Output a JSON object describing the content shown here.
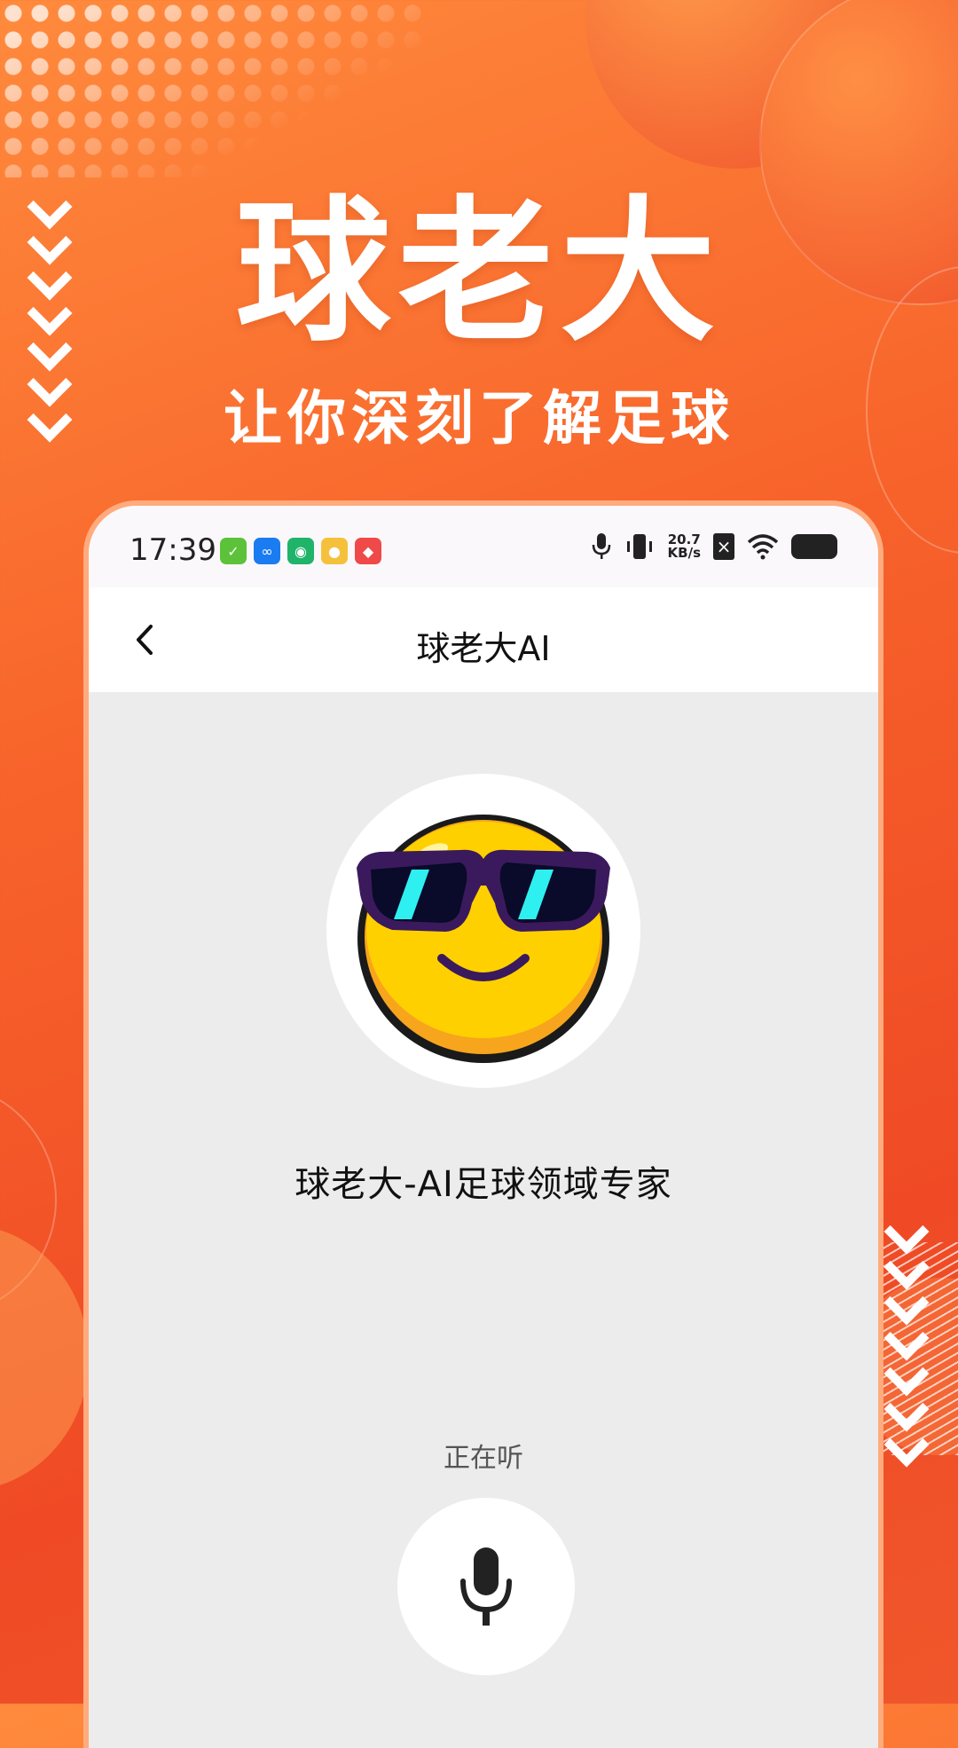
{
  "promo": {
    "headline": "球老大",
    "subline": "让你深刻了解足球"
  },
  "status_bar": {
    "time": "17:39",
    "net_speed_value": "20.7",
    "net_speed_unit": "KB/s",
    "app_icons": [
      "wechat-icon",
      "link-app-icon",
      "meituan-icon",
      "weibo-icon",
      "taobao-icon"
    ]
  },
  "nav": {
    "title": "球老大AI"
  },
  "main": {
    "avatar_icon": "cool-sunglasses-emoji",
    "expert_title": "球老大-AI足球领域专家",
    "listening_label": "正在听",
    "mic_icon": "microphone-icon"
  },
  "colors": {
    "accent": "#f7622a",
    "background_gray": "#ececec"
  }
}
